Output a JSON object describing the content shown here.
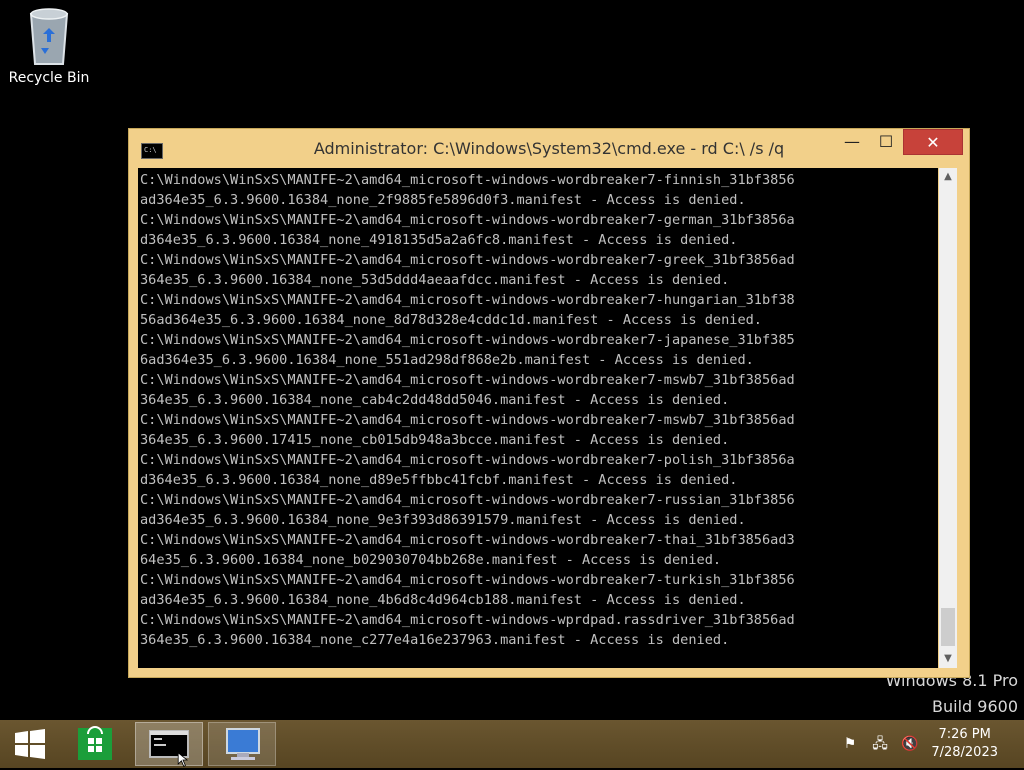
{
  "desktop": {
    "recycle_bin_label": "Recycle Bin"
  },
  "watermark": {
    "line1": "Windows 8.1 Pro",
    "line2": "Build 9600"
  },
  "window": {
    "title": "Administrator: C:\\Windows\\System32\\cmd.exe - rd  C:\\ /s /q",
    "minimize_label": "—",
    "maximize_label": "☐",
    "close_label": "✕",
    "console_lines": [
      "C:\\Windows\\WinSxS\\MANIFE~2\\amd64_microsoft-windows-wordbreaker7-finnish_31bf3856",
      "ad364e35_6.3.9600.16384_none_2f9885fe5896d0f3.manifest - Access is denied.",
      "C:\\Windows\\WinSxS\\MANIFE~2\\amd64_microsoft-windows-wordbreaker7-german_31bf3856a",
      "d364e35_6.3.9600.16384_none_4918135d5a2a6fc8.manifest - Access is denied.",
      "C:\\Windows\\WinSxS\\MANIFE~2\\amd64_microsoft-windows-wordbreaker7-greek_31bf3856ad",
      "364e35_6.3.9600.16384_none_53d5ddd4aeaafdcc.manifest - Access is denied.",
      "C:\\Windows\\WinSxS\\MANIFE~2\\amd64_microsoft-windows-wordbreaker7-hungarian_31bf38",
      "56ad364e35_6.3.9600.16384_none_8d78d328e4cddc1d.manifest - Access is denied.",
      "C:\\Windows\\WinSxS\\MANIFE~2\\amd64_microsoft-windows-wordbreaker7-japanese_31bf385",
      "6ad364e35_6.3.9600.16384_none_551ad298df868e2b.manifest - Access is denied.",
      "C:\\Windows\\WinSxS\\MANIFE~2\\amd64_microsoft-windows-wordbreaker7-mswb7_31bf3856ad",
      "364e35_6.3.9600.16384_none_cab4c2dd48dd5046.manifest - Access is denied.",
      "C:\\Windows\\WinSxS\\MANIFE~2\\amd64_microsoft-windows-wordbreaker7-mswb7_31bf3856ad",
      "364e35_6.3.9600.17415_none_cb015db948a3bcce.manifest - Access is denied.",
      "C:\\Windows\\WinSxS\\MANIFE~2\\amd64_microsoft-windows-wordbreaker7-polish_31bf3856a",
      "d364e35_6.3.9600.16384_none_d89e5ffbbc41fcbf.manifest - Access is denied.",
      "C:\\Windows\\WinSxS\\MANIFE~2\\amd64_microsoft-windows-wordbreaker7-russian_31bf3856",
      "ad364e35_6.3.9600.16384_none_9e3f393d86391579.manifest - Access is denied.",
      "C:\\Windows\\WinSxS\\MANIFE~2\\amd64_microsoft-windows-wordbreaker7-thai_31bf3856ad3",
      "64e35_6.3.9600.16384_none_b029030704bb268e.manifest - Access is denied.",
      "C:\\Windows\\WinSxS\\MANIFE~2\\amd64_microsoft-windows-wordbreaker7-turkish_31bf3856",
      "ad364e35_6.3.9600.16384_none_4b6d8c4d964cb188.manifest - Access is denied.",
      "C:\\Windows\\WinSxS\\MANIFE~2\\amd64_microsoft-windows-wprdpad.rassdriver_31bf3856ad",
      "364e35_6.3.9600.16384_none_c277e4a16e237963.manifest - Access is denied."
    ]
  },
  "taskbar": {
    "clock_time": "7:26 PM",
    "clock_date": "7/28/2023"
  },
  "colors": {
    "window_frame": "#f2d08a",
    "taskbar": "#5a4a2a",
    "close_button": "#c7423a",
    "console_text": "#c0c0c0"
  }
}
